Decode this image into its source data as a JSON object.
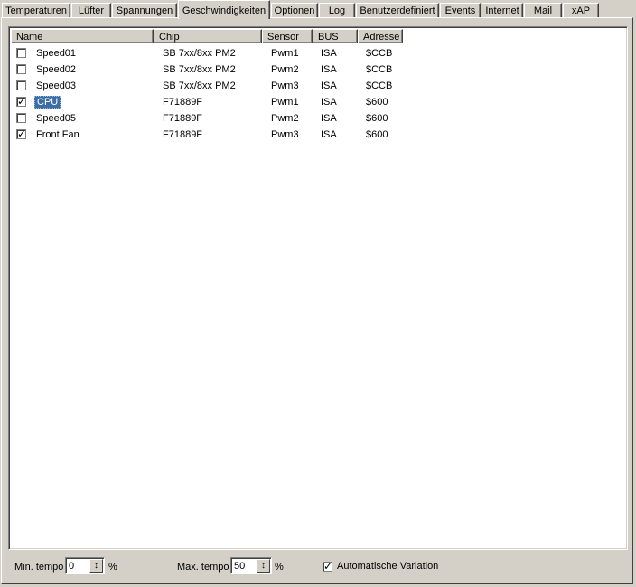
{
  "tabs": [
    {
      "label": "Temperaturen"
    },
    {
      "label": "Lüfter"
    },
    {
      "label": "Spannungen"
    },
    {
      "label": "Geschwindigkeiten",
      "active": true
    },
    {
      "label": "Optionen"
    },
    {
      "label": "Log"
    },
    {
      "label": "Benutzerdefiniert"
    },
    {
      "label": "Events"
    },
    {
      "label": "Internet"
    },
    {
      "label": "Mail"
    },
    {
      "label": "xAP"
    }
  ],
  "list": {
    "columns": [
      "Name",
      "Chip",
      "Sensor",
      "BUS",
      "Adresse"
    ],
    "rows": [
      {
        "checked": false,
        "selected": false,
        "name": "Speed01",
        "chip": "SB 7xx/8xx PM2",
        "sensor": "Pwm1",
        "bus": "ISA",
        "address": "$CCB"
      },
      {
        "checked": false,
        "selected": false,
        "name": "Speed02",
        "chip": "SB 7xx/8xx PM2",
        "sensor": "Pwm2",
        "bus": "ISA",
        "address": "$CCB"
      },
      {
        "checked": false,
        "selected": false,
        "name": "Speed03",
        "chip": "SB 7xx/8xx PM2",
        "sensor": "Pwm3",
        "bus": "ISA",
        "address": "$CCB"
      },
      {
        "checked": true,
        "selected": true,
        "name": "CPU",
        "chip": "F71889F",
        "sensor": "Pwm1",
        "bus": "ISA",
        "address": "$600"
      },
      {
        "checked": false,
        "selected": false,
        "name": "Speed05",
        "chip": "F71889F",
        "sensor": "Pwm2",
        "bus": "ISA",
        "address": "$600"
      },
      {
        "checked": true,
        "selected": false,
        "name": "Front Fan",
        "chip": "F71889F",
        "sensor": "Pwm3",
        "bus": "ISA",
        "address": "$600"
      }
    ]
  },
  "controls": {
    "min_label": "Min. tempo",
    "min_value": "0",
    "min_unit": "%",
    "max_label": "Max. tempo",
    "max_value": "50",
    "max_unit": "%",
    "auto_label": "Automatische Variation",
    "auto_checked": true,
    "check_glyph": "✓",
    "spin_glyph": "↕"
  }
}
